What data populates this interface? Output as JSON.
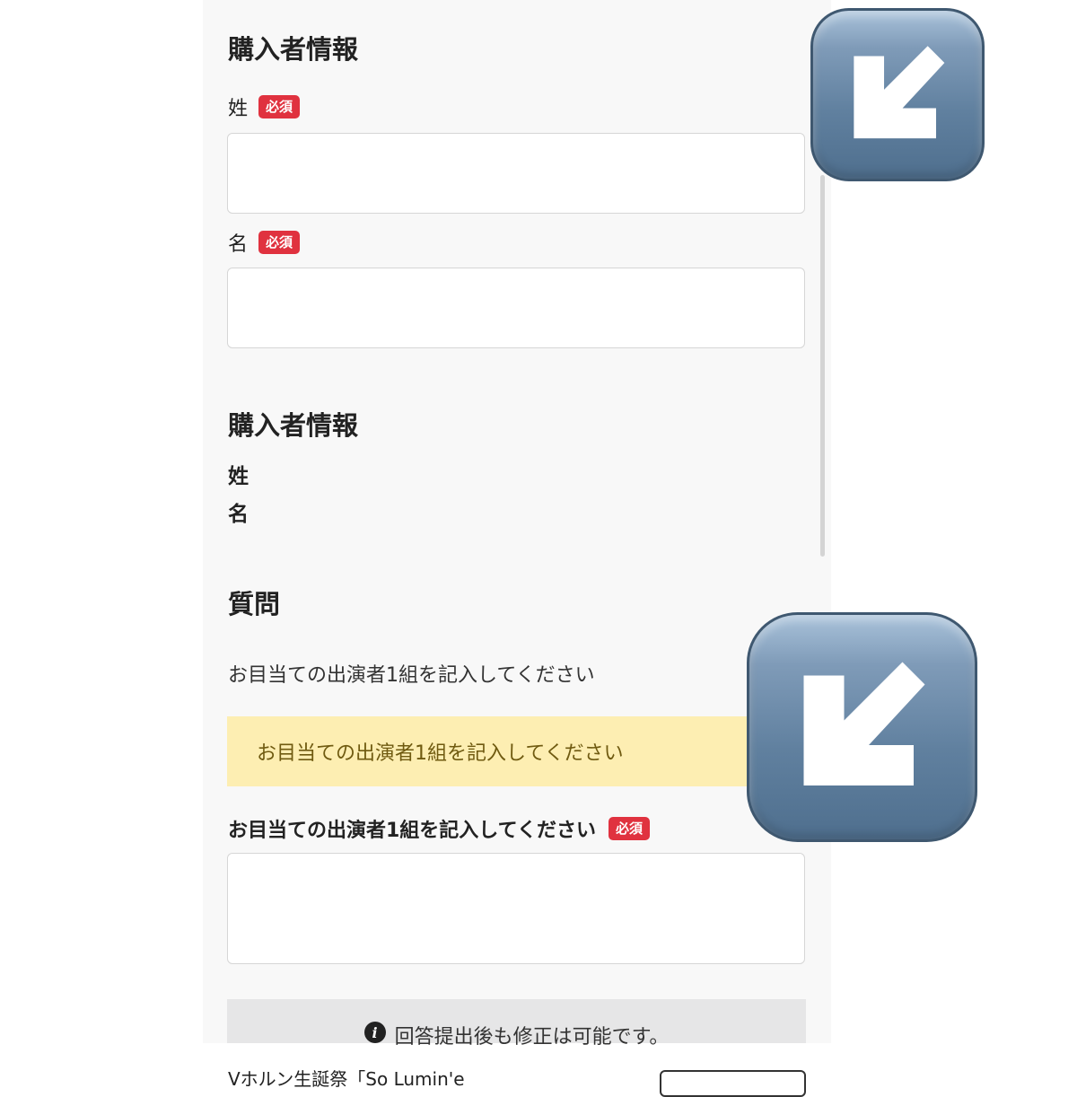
{
  "buyer_form": {
    "heading": "購入者情報",
    "last_name_label": "姓",
    "first_name_label": "名",
    "required_badge": "必須",
    "last_name_value": "",
    "first_name_value": ""
  },
  "buyer_confirm": {
    "heading": "購入者情報",
    "last_name_label": "姓",
    "first_name_label": "名"
  },
  "question": {
    "heading": "質問",
    "text": "お目当ての出演者1組を記入してください",
    "notice": "お目当ての出演者1組を記入してください",
    "field_label": "お目当ての出演者1組を記入してください",
    "required_badge": "必須",
    "answer_value": ""
  },
  "info": {
    "icon": "info-icon",
    "text": "回答提出後も修正は可能です。"
  },
  "footer": {
    "text": "Vホルン生誕祭「So Lumin'e"
  },
  "overlays": {
    "icon": "down-left-arrow-emoji",
    "color": "#6383a3"
  }
}
